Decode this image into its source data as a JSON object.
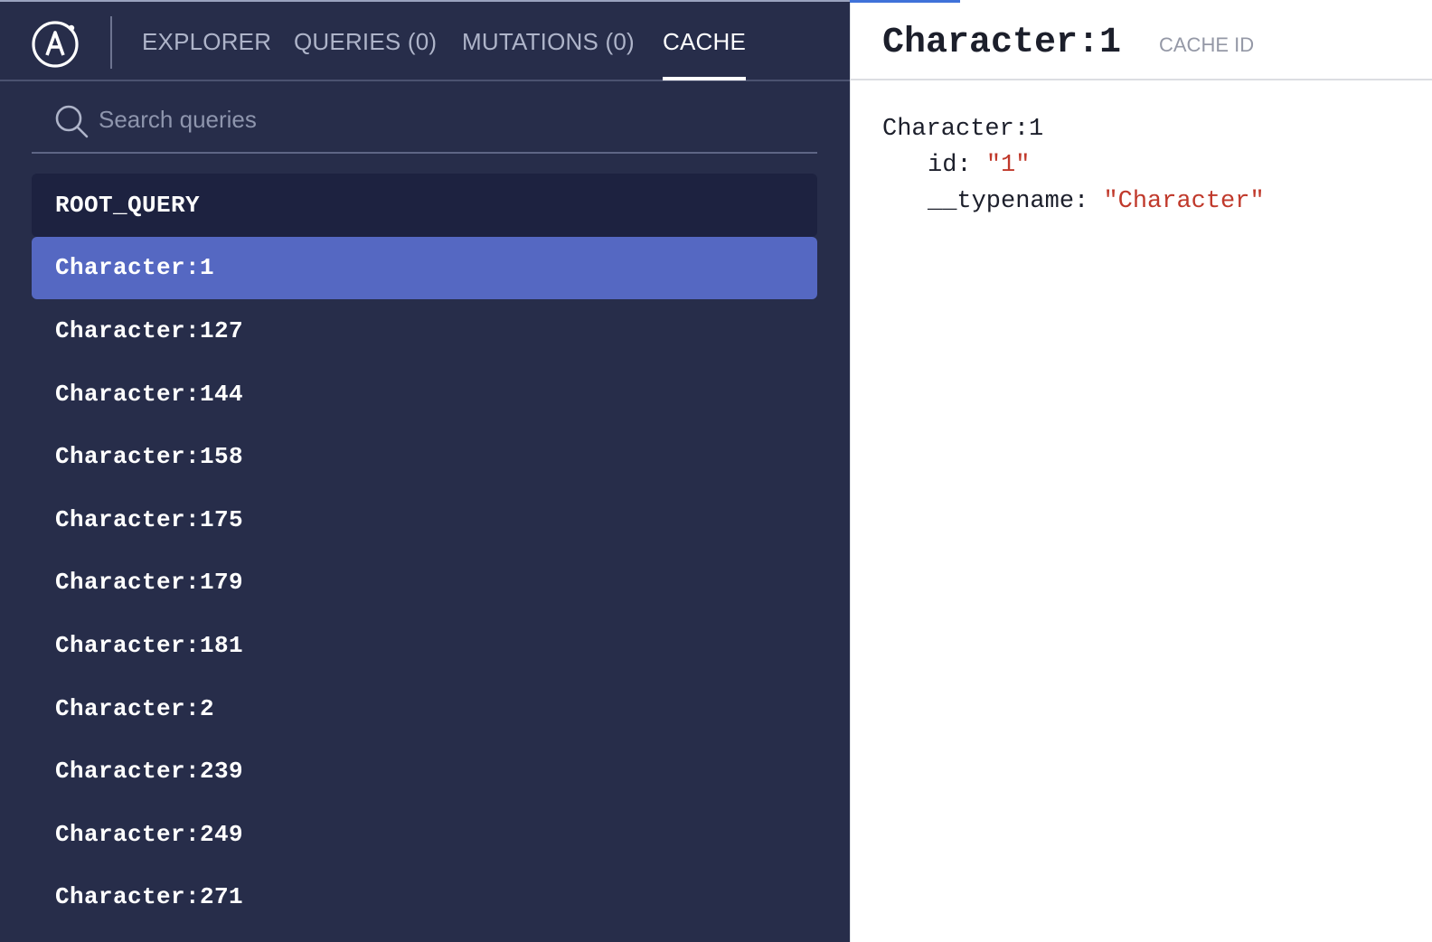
{
  "nav": {
    "tabs": [
      {
        "label": "EXPLORER"
      },
      {
        "label": "QUERIES (0)"
      },
      {
        "label": "MUTATIONS (0)"
      },
      {
        "label": "CACHE"
      }
    ],
    "active_tab": "CACHE"
  },
  "search": {
    "placeholder": "Search queries",
    "value": ""
  },
  "cache_list": {
    "items": [
      {
        "label": "ROOT_QUERY"
      },
      {
        "label": "Character:1"
      },
      {
        "label": "Character:127"
      },
      {
        "label": "Character:144"
      },
      {
        "label": "Character:158"
      },
      {
        "label": "Character:175"
      },
      {
        "label": "Character:179"
      },
      {
        "label": "Character:181"
      },
      {
        "label": "Character:2"
      },
      {
        "label": "Character:239"
      },
      {
        "label": "Character:249"
      },
      {
        "label": "Character:271"
      }
    ],
    "selected": "Character:1"
  },
  "detail": {
    "title": "Character:1",
    "subtitle": "CACHE ID",
    "object_name": "Character:1",
    "fields": [
      {
        "key": "id",
        "value": "\"1\""
      },
      {
        "key": "__typename",
        "value": "\"Character\""
      }
    ]
  },
  "colors": {
    "sidebar_bg": "#272d4a",
    "root_row_bg": "#1d2240",
    "selected_row_bg": "#5568c2",
    "string_value": "#c0392b",
    "accent_line": "#3f72d9"
  },
  "icons": {
    "logo": "apollo-logo-icon",
    "search": "search-icon"
  }
}
